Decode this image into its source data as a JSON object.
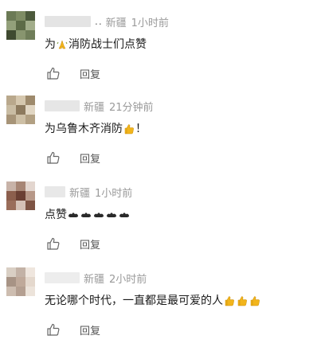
{
  "comments": [
    {
      "name_suffix": "..",
      "location": "新疆",
      "time": "1小时前",
      "text": "为",
      "text_after": "消防战士们点赞",
      "reply_label": "回复",
      "avatar_colors": [
        "#6b7a55",
        "#7e8c64",
        "#4c5a3c",
        "#93a07a",
        "#5d6b47",
        "#a2ad8a",
        "#3f4a30",
        "#88956f",
        "#6f7d59"
      ],
      "name_color": "#e4e4e4"
    },
    {
      "name_suffix": "",
      "location": "新疆",
      "time": "21分钟前",
      "text": "为乌鲁木齐消防",
      "text_after": "！",
      "reply_label": "回复",
      "avatar_colors": [
        "#b9a88c",
        "#d5c7ae",
        "#9e8a6c",
        "#c9bca3",
        "#8d7a5e",
        "#e1d6c3",
        "#a79478",
        "#cdbfa5",
        "#b2a083"
      ],
      "name_color": "#e6e6e6"
    },
    {
      "name_suffix": "",
      "location": "新疆",
      "time": "1小时前",
      "text": "点赞",
      "text_after": "",
      "reply_label": "回复",
      "avatar_colors": [
        "#c8b3a8",
        "#a78675",
        "#e3d6cf",
        "#8c5f4d",
        "#6a3f33",
        "#b79888",
        "#9a6d5a",
        "#d5c1b6",
        "#7e5444"
      ],
      "name_color": "#e8e8e8"
    },
    {
      "name_suffix": "",
      "location": "新疆",
      "time": "2小时前",
      "text": "无论哪个时代，一直都是最可爱的人",
      "text_after": "",
      "reply_label": "回复",
      "avatar_colors": [
        "#d9cfc4",
        "#c3b2a6",
        "#efe6de",
        "#a79385",
        "#bfa99a",
        "#e4d8cd",
        "#cdbdb0",
        "#b49f91",
        "#ece3da"
      ],
      "name_color": "#ededed"
    }
  ],
  "icons": {
    "like": "thumbs-up-outline-icon",
    "pray_emoji": "praying-hands-emoji",
    "thumbs_emoji": "thumbs-up-emoji",
    "clap_emoji": "dark-hands-emoji"
  },
  "accent": {
    "muted_text": "#9a9a9a",
    "emoji_yellow": "#f2b51c"
  }
}
